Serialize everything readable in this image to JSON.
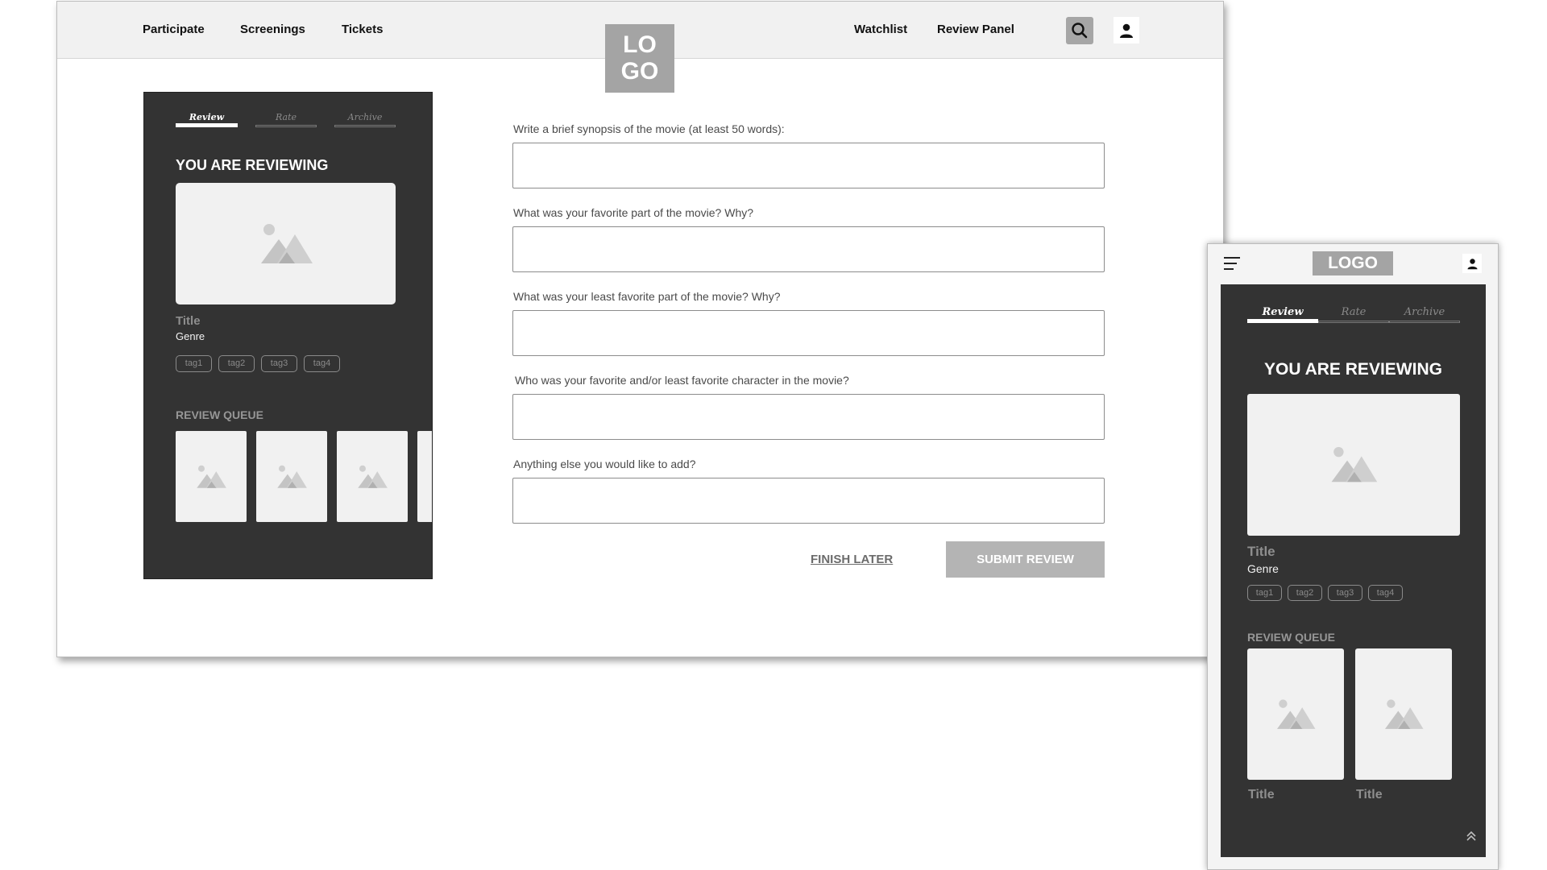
{
  "desktop": {
    "nav_left": [
      "Participate",
      "Screenings",
      "Tickets"
    ],
    "nav_right": [
      "Watchlist",
      "Review Panel"
    ],
    "logo_lines": [
      "LO",
      "GO"
    ],
    "search_icon": "search-icon",
    "user_icon": "user-icon",
    "panel": {
      "tabs": [
        "Review",
        "Rate",
        "Archive"
      ],
      "active_tab": "Review",
      "heading": "YOU ARE REVIEWING",
      "movie_title": "Title",
      "movie_genre": "Genre",
      "tags": [
        "tag1",
        "tag2",
        "tag3",
        "tag4"
      ],
      "queue_heading": "REVIEW QUEUE"
    },
    "form": {
      "questions": [
        "Write a brief synopsis of the movie (at least 50 words):",
        "What was your favorite part of the movie? Why?",
        "What was your least favorite part of the movie? Why?",
        "Who was your favorite and/or least favorite character in the movie?",
        "Anything else you would like to add?"
      ],
      "values": [
        "",
        "",
        "",
        "",
        ""
      ],
      "finish_later": "FINISH LATER",
      "submit": "SUBMIT REVIEW"
    }
  },
  "mobile": {
    "logo": "LOGO",
    "menu_icon": "hamburger-menu-icon",
    "user_icon": "user-icon",
    "panel": {
      "tabs": [
        "Review",
        "Rate",
        "Archive"
      ],
      "active_tab": "Review",
      "heading": "YOU ARE REVIEWING",
      "movie_title": "Title",
      "movie_genre": "Genre",
      "tags": [
        "tag1",
        "tag2",
        "tag3",
        "tag4"
      ],
      "queue_heading": "REVIEW QUEUE",
      "queue_titles": [
        "Title",
        "Title"
      ]
    },
    "scroll_top_icon": "chevrons-up-icon"
  },
  "colors": {
    "panel_bg": "#333333",
    "placeholder_bg": "#f1f1f1",
    "logo_bg": "#a4a4a4",
    "button_bg": "#b4b4b4"
  }
}
